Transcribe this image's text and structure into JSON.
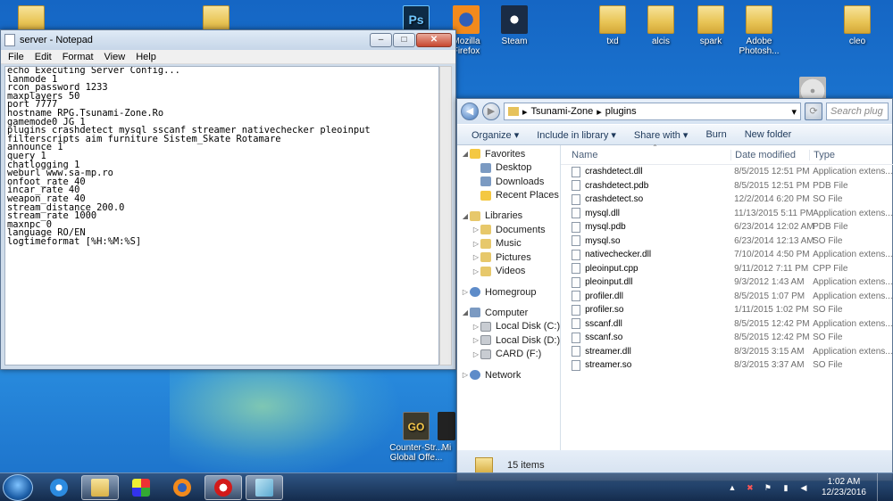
{
  "desktop": {
    "icons": [
      {
        "label": "Mozilla Firefox",
        "kind": "firefox"
      },
      {
        "label": "Steam",
        "kind": "steam"
      },
      {
        "label": "txd",
        "kind": "folder"
      },
      {
        "label": "alcis",
        "kind": "folder"
      },
      {
        "label": "spark",
        "kind": "folder"
      },
      {
        "label": "Adobe Photosh...",
        "kind": "folder"
      },
      {
        "label": "cleo",
        "kind": "folder"
      },
      {
        "label": "Counter-Str... Global Offe...",
        "kind": "csgo"
      },
      {
        "label": "Mi",
        "kind": "app"
      }
    ]
  },
  "notepad": {
    "title": "server - Notepad",
    "menu": [
      "File",
      "Edit",
      "Format",
      "View",
      "Help"
    ],
    "lines": [
      "echo Executing Server Config...",
      "lanmode 1",
      "rcon_password 1233",
      "maxplayers 50",
      "port 7777",
      "hostname RPG.Tsunami-Zone.Ro",
      "gamemode0 JG 1",
      "plugins crashdetect mysql sscanf streamer nativechecker pleoinput",
      "filterscripts aim furniture Sistem_Skate Rotamare",
      "announce 1",
      "query 1",
      "chatlogging 1",
      "weburl www.sa-mp.ro",
      "onfoot_rate 40",
      "incar_rate 40",
      "weapon_rate 40",
      "stream_distance 200.0",
      "stream_rate 1000",
      "maxnpc 0",
      "language RO/EN",
      "logtimeformat [%H:%M:%S]"
    ]
  },
  "explorer": {
    "breadcrumb": [
      "Tsunami-Zone",
      "plugins"
    ],
    "search_placeholder": "Search plug",
    "toolbar": [
      "Organize ▾",
      "Include in library ▾",
      "Share with ▾",
      "Burn",
      "New folder"
    ],
    "nav": [
      {
        "label": "Favorites",
        "level": 0,
        "icon": "fav",
        "expander": "◢"
      },
      {
        "label": "Desktop",
        "level": 1,
        "icon": "desktop"
      },
      {
        "label": "Downloads",
        "level": 1,
        "icon": "downloads"
      },
      {
        "label": "Recent Places",
        "level": 1,
        "icon": "recent"
      },
      {
        "label": "",
        "level": -1
      },
      {
        "label": "Libraries",
        "level": 0,
        "icon": "lib",
        "expander": "◢"
      },
      {
        "label": "Documents",
        "level": 1,
        "icon": "lib",
        "expander": "▷"
      },
      {
        "label": "Music",
        "level": 1,
        "icon": "lib",
        "expander": "▷"
      },
      {
        "label": "Pictures",
        "level": 1,
        "icon": "lib",
        "expander": "▷"
      },
      {
        "label": "Videos",
        "level": 1,
        "icon": "lib",
        "expander": "▷"
      },
      {
        "label": "",
        "level": -1
      },
      {
        "label": "Homegroup",
        "level": 0,
        "icon": "net",
        "expander": "▷"
      },
      {
        "label": "",
        "level": -1
      },
      {
        "label": "Computer",
        "level": 0,
        "icon": "pc",
        "expander": "◢"
      },
      {
        "label": "Local Disk (C:)",
        "level": 1,
        "icon": "drive",
        "expander": "▷"
      },
      {
        "label": "Local Disk (D:)",
        "level": 1,
        "icon": "drive",
        "expander": "▷"
      },
      {
        "label": "CARD (F:)",
        "level": 1,
        "icon": "drive",
        "expander": "▷"
      },
      {
        "label": "",
        "level": -1
      },
      {
        "label": "Network",
        "level": 0,
        "icon": "net",
        "expander": "▷"
      }
    ],
    "columns": {
      "name": "Name",
      "date": "Date modified",
      "type": "Type"
    },
    "files": [
      {
        "name": "crashdetect.dll",
        "date": "8/5/2015 12:51 PM",
        "type": "Application extens..."
      },
      {
        "name": "crashdetect.pdb",
        "date": "8/5/2015 12:51 PM",
        "type": "PDB File"
      },
      {
        "name": "crashdetect.so",
        "date": "12/2/2014 6:20 PM",
        "type": "SO File"
      },
      {
        "name": "mysql.dll",
        "date": "11/13/2015 5:11 PM",
        "type": "Application extens..."
      },
      {
        "name": "mysql.pdb",
        "date": "6/23/2014 12:02 AM",
        "type": "PDB File"
      },
      {
        "name": "mysql.so",
        "date": "6/23/2014 12:13 AM",
        "type": "SO File"
      },
      {
        "name": "nativechecker.dll",
        "date": "7/10/2014 4:50 PM",
        "type": "Application extens..."
      },
      {
        "name": "pleoinput.cpp",
        "date": "9/11/2012 7:11 PM",
        "type": "CPP File"
      },
      {
        "name": "pleoinput.dll",
        "date": "9/3/2012 1:43 AM",
        "type": "Application extens..."
      },
      {
        "name": "profiler.dll",
        "date": "8/5/2015 1:07 PM",
        "type": "Application extens..."
      },
      {
        "name": "profiler.so",
        "date": "1/11/2015 1:02 PM",
        "type": "SO File"
      },
      {
        "name": "sscanf.dll",
        "date": "8/5/2015 12:42 PM",
        "type": "Application extens..."
      },
      {
        "name": "sscanf.so",
        "date": "8/5/2015 12:42 PM",
        "type": "SO File"
      },
      {
        "name": "streamer.dll",
        "date": "8/3/2015 3:15 AM",
        "type": "Application extens..."
      },
      {
        "name": "streamer.so",
        "date": "8/3/2015 3:37 AM",
        "type": "SO File"
      }
    ],
    "status": "15 items"
  },
  "taskbar": {
    "apps": [
      "internet-explorer",
      "windows-explorer",
      "paint",
      "firefox",
      "opera",
      "notepad"
    ],
    "time": "1:02 AM",
    "date": "12/23/2016"
  }
}
